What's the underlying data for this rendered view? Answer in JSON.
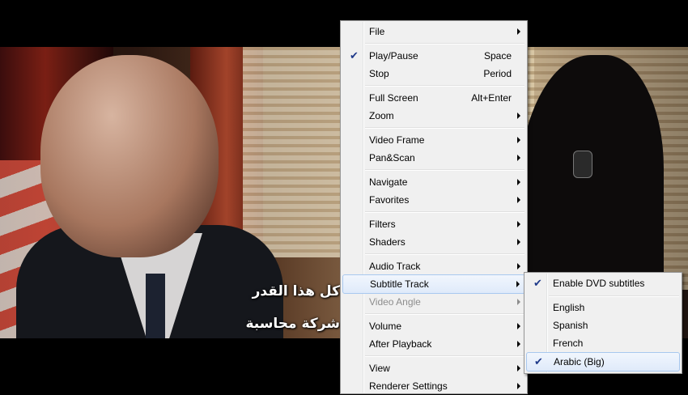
{
  "video": {
    "subtitle_line1": "كل هذا القدر",
    "subtitle_line2": "شركة محاسبة"
  },
  "menu": {
    "items": [
      {
        "label": "File",
        "submenu": true
      },
      {
        "label": "Play/Pause",
        "accel": "Space",
        "checked": true
      },
      {
        "label": "Stop",
        "accel": "Period"
      },
      {
        "label": "Full Screen",
        "accel": "Alt+Enter"
      },
      {
        "label": "Zoom",
        "submenu": true
      },
      {
        "label": "Video Frame",
        "submenu": true
      },
      {
        "label": "Pan&Scan",
        "submenu": true
      },
      {
        "label": "Navigate",
        "submenu": true
      },
      {
        "label": "Favorites",
        "submenu": true
      },
      {
        "label": "Filters",
        "submenu": true
      },
      {
        "label": "Shaders",
        "submenu": true
      },
      {
        "label": "Audio Track",
        "submenu": true
      },
      {
        "label": "Subtitle Track",
        "submenu": true,
        "highlighted": true
      },
      {
        "label": "Video Angle",
        "submenu": true,
        "disabled": true
      },
      {
        "label": "Volume",
        "submenu": true
      },
      {
        "label": "After Playback",
        "submenu": true
      },
      {
        "label": "View",
        "submenu": true
      },
      {
        "label": "Renderer Settings",
        "submenu": true
      }
    ]
  },
  "subtitle_menu": {
    "items": [
      {
        "label": "Enable DVD subtitles",
        "checked": true
      },
      {
        "label": "English"
      },
      {
        "label": "Spanish"
      },
      {
        "label": "French"
      },
      {
        "label": "Arabic (Big)",
        "checked": true,
        "highlighted": true
      }
    ]
  },
  "colors": {
    "menu_bg": "#f0f0f0",
    "highlight_border": "#a8c8ef",
    "check_color": "#1f3a8a"
  },
  "icons": {
    "check": "checkmark-icon",
    "submenu": "submenu-arrow-icon"
  }
}
